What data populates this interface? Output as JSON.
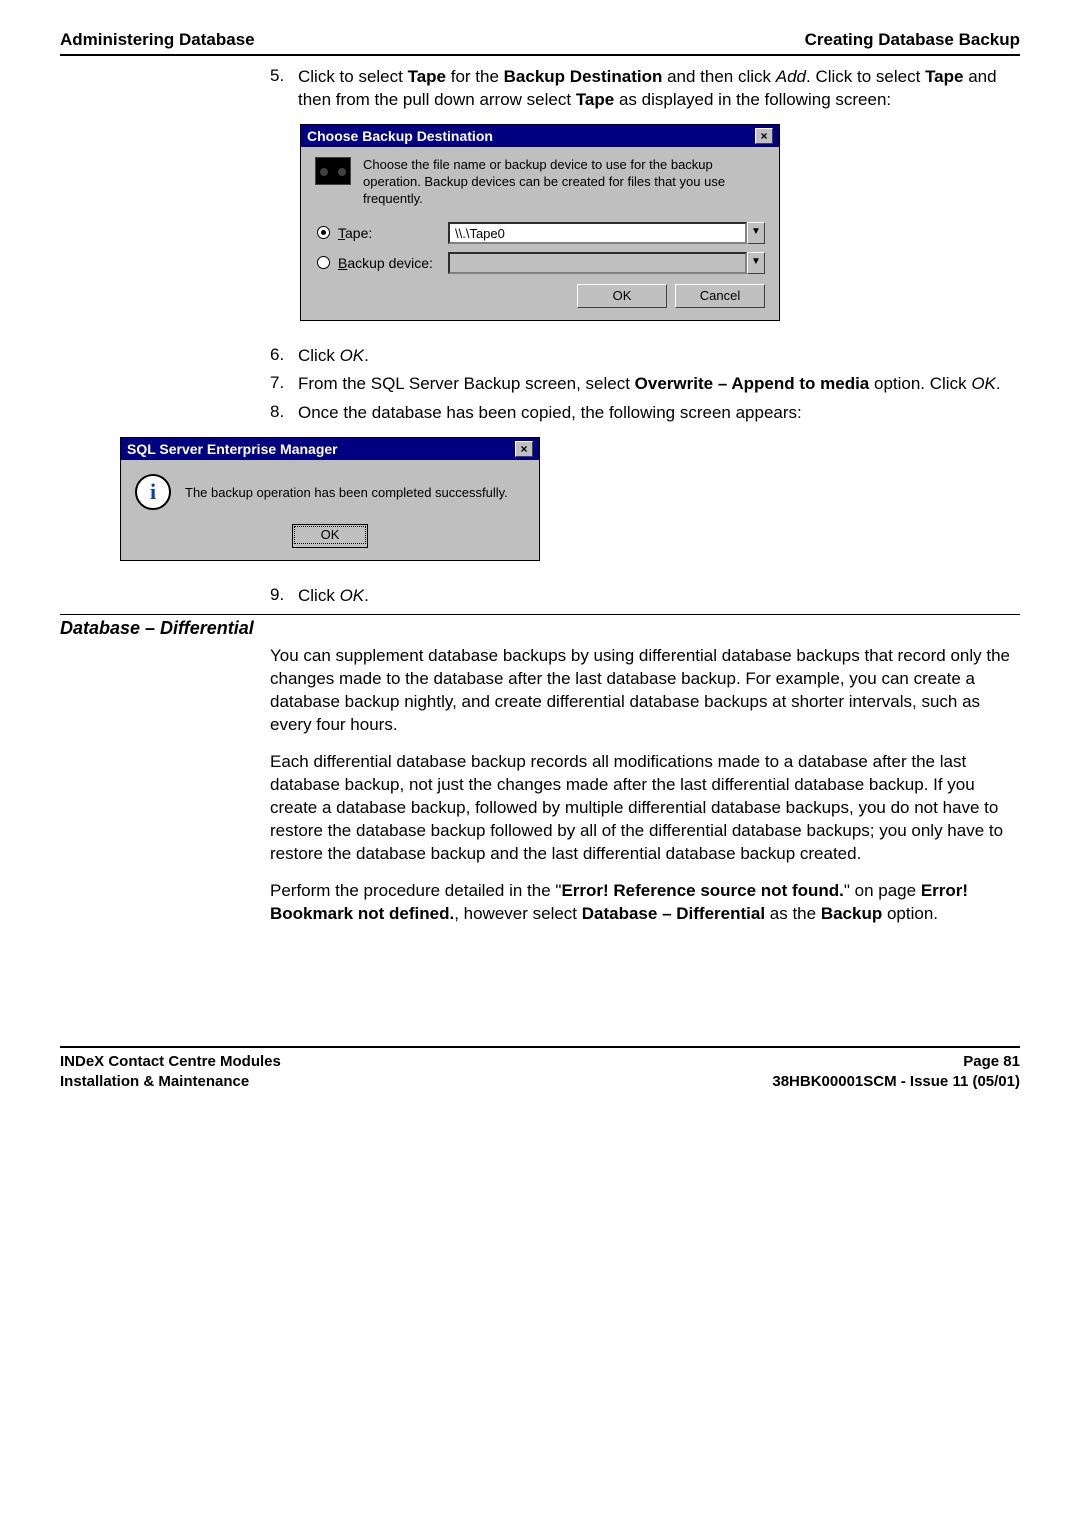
{
  "header": {
    "left": "Administering Database",
    "right": "Creating Database Backup"
  },
  "step5": {
    "num": "5.",
    "text_a": "Click to select ",
    "b1": "Tape",
    "text_b": " for the ",
    "b2": "Backup Destination",
    "text_c": " and then click ",
    "i1": "Add",
    "text_d": ".  Click to select ",
    "b3": "Tape",
    "text_e": " and then from the pull down arrow select ",
    "b4": "Tape",
    "text_f": " as displayed in the following screen:"
  },
  "dlg1": {
    "title": "Choose Backup Destination",
    "close_label": "×",
    "desc": "Choose the file name or backup device to use for the backup operation.  Backup devices can be created for files that you use frequently.",
    "tape_underline": "T",
    "tape_rest": "ape:",
    "backup_underline": "B",
    "backup_rest": "ackup device:",
    "tape_value": "\\\\.\\Tape0",
    "arrow": "▼",
    "ok": "OK",
    "cancel": "Cancel"
  },
  "step6": {
    "num": "6.",
    "text_a": "Click ",
    "i1": "OK",
    "text_b": "."
  },
  "step7": {
    "num": "7.",
    "text_a": "From the SQL Server Backup screen, select ",
    "b1": "Overwrite – Append to media",
    "text_b": " option.  Click ",
    "i1": "OK",
    "text_c": "."
  },
  "step8": {
    "num": "8.",
    "text": "Once the database has been copied, the following screen appears:"
  },
  "dlg2": {
    "title": "SQL Server Enterprise Manager",
    "close_label": "×",
    "info_glyph": "i",
    "msg": "The backup operation has been completed successfully.",
    "ok": "OK"
  },
  "step9": {
    "num": "9.",
    "text_a": "Click ",
    "i1": "OK",
    "text_b": "."
  },
  "subheading": "Database – Differential",
  "p1": "You can supplement database backups by using differential database backups that record only the changes made to the database after the last database backup.  For example, you can create a database backup nightly, and create differential database backups at shorter intervals, such as every four hours.",
  "p2": "Each differential database backup records all modifications made to a database after the last database backup, not just the changes made after the last differential database backup.  If you create a database backup, followed by multiple differential database backups, you do not have to restore the database backup followed by all of the differential database backups; you only have to restore the database backup and the last differential database backup created.",
  "p3": {
    "a": "Perform the procedure detailed in the \"",
    "b1": "Error! Reference source not found.",
    "b": "\" on page ",
    "b2": "Error! Bookmark not defined.",
    "c": ", however select ",
    "b3": "Database – Differential",
    "d": " as the ",
    "b4": "Backup",
    "e": " option."
  },
  "footer": {
    "l1": "INDeX Contact Centre Modules",
    "l2": "Installation & Maintenance",
    "r1": "Page 81",
    "r2": "38HBK00001SCM - Issue 11 (05/01)"
  }
}
